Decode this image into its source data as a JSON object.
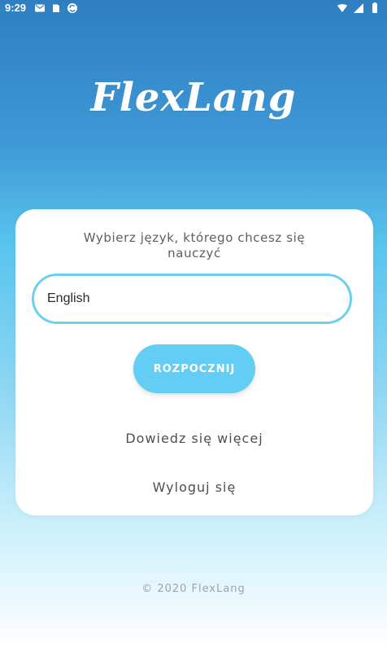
{
  "status_bar": {
    "time": "9:29",
    "left_icons": [
      "gmail-icon",
      "sim-card-icon",
      "sync-icon"
    ],
    "right_icons": [
      "wifi-icon",
      "signal-icon",
      "battery-icon"
    ]
  },
  "app": {
    "logo_text": "FlexLang"
  },
  "card": {
    "title": "Wybierz język, którego chcesz się nauczyć",
    "language_value": "English",
    "start_button_label": "ROZPOCZNIJ",
    "learn_more_link": "Dowiedz się więcej",
    "logout_link": "Wyloguj się"
  },
  "footer": {
    "copyright": "© 2020 FlexLang"
  },
  "colors": {
    "accent": "#63cdf3",
    "input_border": "#6ccfee",
    "text_dark": "#4f4f4f",
    "footer_text": "#9aa4aa"
  }
}
